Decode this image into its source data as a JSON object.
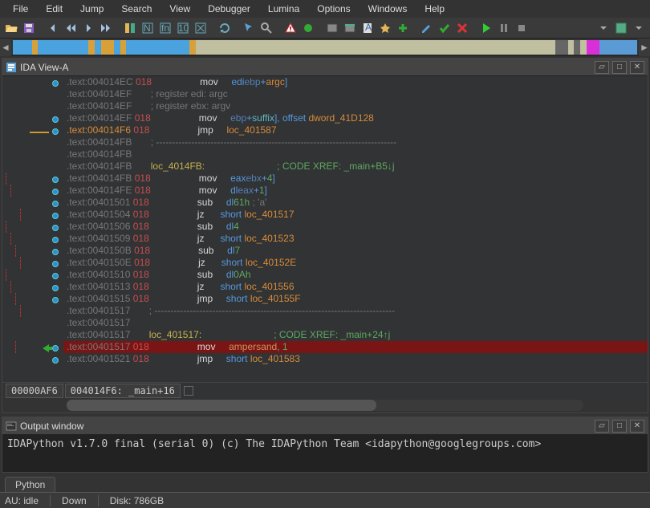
{
  "menu": [
    "File",
    "Edit",
    "Jump",
    "Search",
    "View",
    "Debugger",
    "Lumina",
    "Options",
    "Windows",
    "Help"
  ],
  "panels": {
    "ida_view_title": "IDA View-A",
    "output_title": "Output window"
  },
  "nav_segments": [
    {
      "w": 3,
      "c": "#4aa3df"
    },
    {
      "w": 1,
      "c": "#d8a03a"
    },
    {
      "w": 8,
      "c": "#4aa3df"
    },
    {
      "w": 1,
      "c": "#d8a03a"
    },
    {
      "w": 1,
      "c": "#4aa3df"
    },
    {
      "w": 2,
      "c": "#d8a03a"
    },
    {
      "w": 1,
      "c": "#4aa3df"
    },
    {
      "w": 1,
      "c": "#d8a03a"
    },
    {
      "w": 10,
      "c": "#4aa3df"
    },
    {
      "w": 1,
      "c": "#d8a03a"
    },
    {
      "w": 57,
      "c": "#c0bfa0"
    },
    {
      "w": 2,
      "c": "#666"
    },
    {
      "w": 1,
      "c": "#c0bfa0"
    },
    {
      "w": 1,
      "c": "#666"
    },
    {
      "w": 1,
      "c": "#c0bfa0"
    },
    {
      "w": 2,
      "c": "#d82fd8"
    },
    {
      "w": 6,
      "c": "#5b9bd5"
    }
  ],
  "disasm": [
    {
      "dot": true,
      "a": ".text:004014EC",
      "s": "018",
      "op": "mov",
      "args": [
        [
          "edi",
          ", ["
        ],
        [
          "ebp",
          "navy"
        ],
        [
          "+",
          ""
        ],
        [
          "argc",
          "orange"
        ],
        [
          "]",
          ""
        ]
      ]
    },
    {
      "dot": false,
      "a": ".text:004014EF",
      "s": "   ",
      "cm": "; register edi: argc"
    },
    {
      "dot": false,
      "a": ".text:004014EF",
      "s": "   ",
      "cm": "; register ebx: argv"
    },
    {
      "dot": true,
      "a": ".text:004014EF",
      "s": "018",
      "op": "mov",
      "args": [
        [
          "",
          "["
        ],
        [
          "ebp",
          "navy"
        ],
        [
          "+",
          ""
        ],
        [
          "suffix",
          "cyan"
        ],
        [
          "], ",
          ""
        ],
        [
          "offset ",
          ""
        ],
        [
          "dword_41D128",
          "orange"
        ]
      ]
    },
    {
      "dot": true,
      "yl": true,
      "a": ".text:004014F6",
      "s": "018",
      "bold": true,
      "op": "jmp",
      "args": [
        [
          "loc_401587",
          "orange"
        ]
      ]
    },
    {
      "dot": false,
      "a": ".text:004014FB",
      "s": "   ",
      "cm": "; ---------------------------------------------------------------------------"
    },
    {
      "dot": false,
      "a": ".text:004014FB",
      "s": ""
    },
    {
      "dot": false,
      "a": ".text:004014FB",
      "s": "   ",
      "label": "loc_4014FB:",
      "xref": "; CODE XREF: _main+B5↓j"
    },
    {
      "dot": true,
      "a": ".text:004014FB",
      "s": "018",
      "op": "mov",
      "args": [
        [
          "eax",
          ", ["
        ],
        [
          "ebx",
          "navy"
        ],
        [
          "+",
          ""
        ],
        [
          "4",
          "green"
        ],
        [
          "]",
          ""
        ]
      ]
    },
    {
      "dot": true,
      "a": ".text:004014FE",
      "s": "018",
      "op": "mov",
      "args": [
        [
          "dl",
          ", ["
        ],
        [
          "eax",
          "navy"
        ],
        [
          "+",
          ""
        ],
        [
          "1",
          "green"
        ],
        [
          "]",
          ""
        ]
      ]
    },
    {
      "dot": true,
      "a": ".text:00401501",
      "s": "018",
      "op": "sub",
      "args": [
        [
          "dl",
          ", "
        ],
        [
          "61h ",
          "green"
        ],
        [
          "; 'a'",
          "grey"
        ]
      ]
    },
    {
      "dot": true,
      "a": ".text:00401504",
      "s": "018",
      "op": "jz",
      "args": [
        [
          "short ",
          ""
        ],
        [
          "loc_401517",
          "orange"
        ]
      ]
    },
    {
      "dot": true,
      "a": ".text:00401506",
      "s": "018",
      "op": "sub",
      "args": [
        [
          "dl",
          ", "
        ],
        [
          "4",
          "green"
        ]
      ]
    },
    {
      "dot": true,
      "a": ".text:00401509",
      "s": "018",
      "op": "jz",
      "args": [
        [
          "short ",
          ""
        ],
        [
          "loc_401523",
          "orange"
        ]
      ]
    },
    {
      "dot": true,
      "a": ".text:0040150B",
      "s": "018",
      "op": "sub",
      "args": [
        [
          "dl",
          ", "
        ],
        [
          "7",
          "green"
        ]
      ]
    },
    {
      "dot": true,
      "a": ".text:0040150E",
      "s": "018",
      "op": "jz",
      "args": [
        [
          "short ",
          ""
        ],
        [
          "loc_40152E",
          "orange"
        ]
      ]
    },
    {
      "dot": true,
      "a": ".text:00401510",
      "s": "018",
      "op": "sub",
      "args": [
        [
          "dl",
          ", "
        ],
        [
          "0Ah",
          "green"
        ]
      ]
    },
    {
      "dot": true,
      "a": ".text:00401513",
      "s": "018",
      "op": "jz",
      "args": [
        [
          "short ",
          ""
        ],
        [
          "loc_401556",
          "orange"
        ]
      ]
    },
    {
      "dot": true,
      "a": ".text:00401515",
      "s": "018",
      "op": "jmp",
      "args": [
        [
          "short ",
          ""
        ],
        [
          "loc_40155F",
          "orange"
        ]
      ]
    },
    {
      "dot": false,
      "a": ".text:00401517",
      "s": "   ",
      "cm": "; ---------------------------------------------------------------------------"
    },
    {
      "dot": false,
      "a": ".text:00401517",
      "s": ""
    },
    {
      "dot": false,
      "a": ".text:00401517",
      "s": "   ",
      "label": "loc_401517:",
      "xref": "; CODE XREF: _main+24↑j"
    },
    {
      "dot": true,
      "hl": true,
      "a": ".text:00401517",
      "s": "018",
      "op": "mov",
      "args": [
        [
          "ampersand",
          "str"
        ],
        [
          ", ",
          ""
        ],
        [
          "1",
          "green"
        ]
      ]
    },
    {
      "dot": true,
      "a": ".text:00401521",
      "s": "018",
      "op": "jmp",
      "args": [
        [
          "short ",
          ""
        ],
        [
          "loc_401583",
          "orange"
        ]
      ]
    }
  ],
  "status_boxes": [
    "00000AF6",
    "004014F6: _main+16"
  ],
  "output_text": "IDAPython v1.7.0 final (serial 0) (c) The IDAPython Team <idapython@googlegroups.com>",
  "tab_label": "Python",
  "statusbar": {
    "au": "AU: idle",
    "dir": "Down",
    "disk": "Disk: 786GB"
  }
}
